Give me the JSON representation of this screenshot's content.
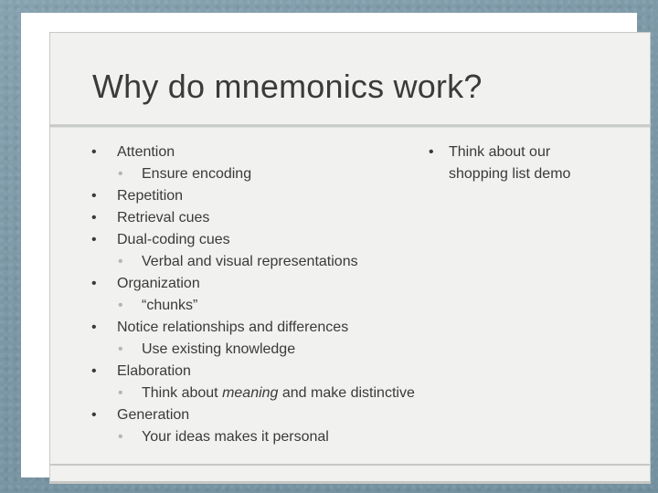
{
  "slide": {
    "title": "Why do mnemonics work?",
    "colors": {
      "canvas": "#7d9aa8",
      "frame": "#ffffff",
      "body": "#f1f1f0",
      "text": "#3a3a3a",
      "sub_bullet": "#b6b6b6",
      "divider": "#c2c5c3"
    },
    "bullet_glyph": "•",
    "left_column": [
      {
        "level": 1,
        "text": "Attention"
      },
      {
        "level": 2,
        "text": "Ensure encoding"
      },
      {
        "level": 1,
        "text": "Repetition"
      },
      {
        "level": 1,
        "text": "Retrieval cues"
      },
      {
        "level": 1,
        "text": "Dual-coding cues"
      },
      {
        "level": 2,
        "text": "Verbal and visual representations"
      },
      {
        "level": 1,
        "text": "Organization"
      },
      {
        "level": 2,
        "text": "“chunks”"
      },
      {
        "level": 1,
        "text": "Notice relationships and differences"
      },
      {
        "level": 2,
        "text": "Use existing knowledge"
      },
      {
        "level": 1,
        "text": "Elaboration"
      },
      {
        "level": 2,
        "text_before": "Think about ",
        "emphasis": "meaning",
        "text_after": " and make distinctive"
      },
      {
        "level": 1,
        "text": "Generation"
      },
      {
        "level": 2,
        "text": "Your ideas makes it personal"
      }
    ],
    "right_column": [
      {
        "level": 1,
        "line1": "Think about our",
        "line2": "shopping list demo"
      }
    ]
  }
}
